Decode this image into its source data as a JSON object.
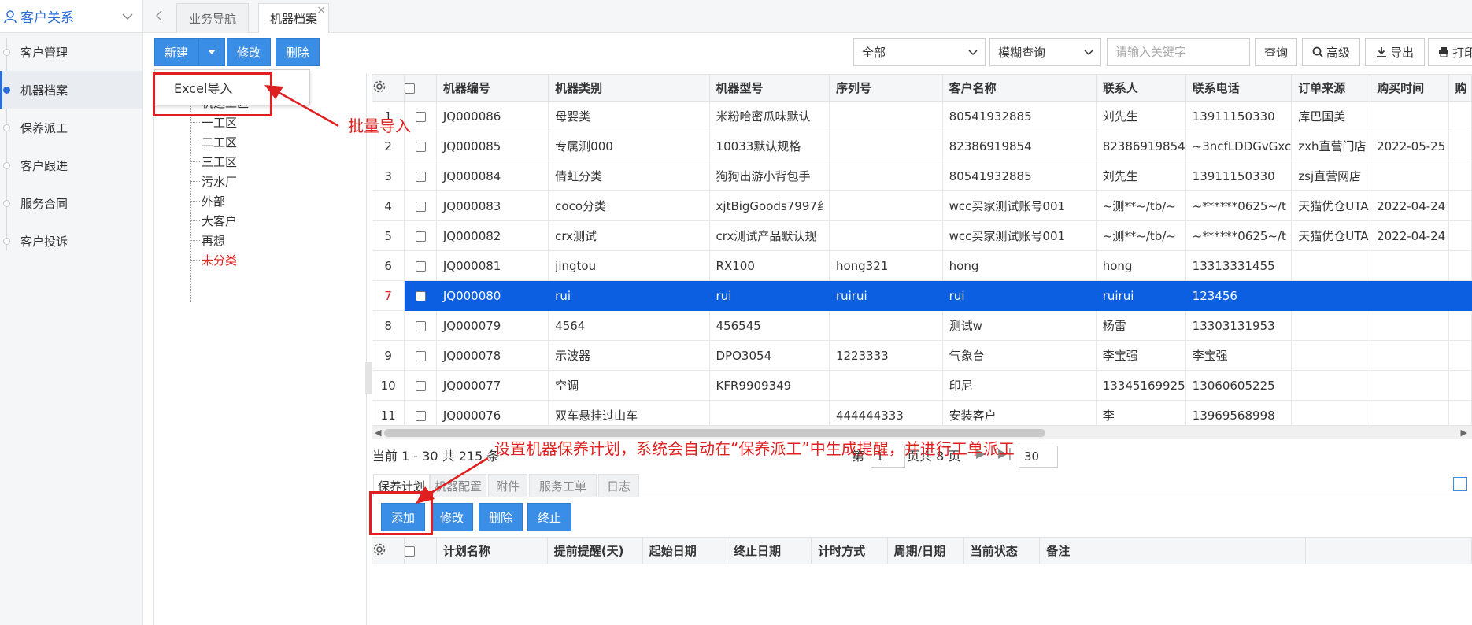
{
  "sidebar": {
    "title": "客户关系",
    "items": [
      {
        "label": "客户管理",
        "active": false
      },
      {
        "label": "机器档案",
        "active": true
      },
      {
        "label": "保养派工",
        "active": false
      },
      {
        "label": "客户跟进",
        "active": false
      },
      {
        "label": "服务合同",
        "active": false
      },
      {
        "label": "客户投诉",
        "active": false
      }
    ]
  },
  "tabs": [
    {
      "label": "业务导航",
      "active": false
    },
    {
      "label": "机器档案",
      "active": true,
      "close": "×"
    }
  ],
  "toolbar": {
    "new_label": "新建",
    "edit_label": "修改",
    "delete_label": "删除",
    "filter_select": "全部",
    "query_mode": "模糊查询",
    "search_placeholder": "请输入关键字",
    "query_label": "查询",
    "advanced_label": "高级",
    "export_label": "导出",
    "print_label": "打印"
  },
  "dropdown": {
    "excel_import": "Excel导入"
  },
  "annotations": {
    "batch_import": "批量导入",
    "maintenance_note": "设置机器保养计划，系统会自动在“保养派工”中生成提醒，并进行工单派工"
  },
  "tree": {
    "items": [
      {
        "label": "机运工区",
        "red": false
      },
      {
        "label": "一工区",
        "red": false
      },
      {
        "label": "二工区",
        "red": false
      },
      {
        "label": "三工区",
        "red": false
      },
      {
        "label": "污水厂",
        "red": false
      },
      {
        "label": "外部",
        "red": false
      },
      {
        "label": "大客户",
        "red": false
      },
      {
        "label": "再想",
        "red": false
      },
      {
        "label": "未分类",
        "red": true
      }
    ]
  },
  "table": {
    "columns": [
      "机器编号",
      "机器类别",
      "机器型号",
      "序列号",
      "客户名称",
      "联系人",
      "联系电话",
      "订单来源",
      "购买时间",
      "购"
    ],
    "rows": [
      {
        "no": "1",
        "cells": [
          "JQ000086",
          "母婴类",
          "米粉哈密瓜味默认",
          "",
          "80541932885",
          "刘先生",
          "13911150330",
          "库巴国美",
          ""
        ],
        "selected": false
      },
      {
        "no": "2",
        "cells": [
          "JQ000085",
          "专属测000",
          "10033默认规格",
          "",
          "82386919854",
          "82386919854",
          "~3ncfLDDGvGxc",
          "zxh直营门店",
          "2022-05-25"
        ],
        "selected": false
      },
      {
        "no": "3",
        "cells": [
          "JQ000084",
          "倩虹分类",
          "狗狗出游小背包手",
          "",
          "80541932885",
          "刘先生",
          "13911150330",
          "zsj直营网店",
          ""
        ],
        "selected": false
      },
      {
        "no": "4",
        "cells": [
          "JQ000083",
          "coco分类",
          "xjtBigGoods7997纟",
          "",
          "wcc买家测试账号001",
          "~测**~/tb/~",
          "~******0625~/t",
          "天猫优仓UTA",
          "2022-04-24"
        ],
        "selected": false
      },
      {
        "no": "5",
        "cells": [
          "JQ000082",
          "crx测试",
          "crx测试产品默认规",
          "",
          "wcc买家测试账号001",
          "~测**~/tb/~",
          "~******0625~/t",
          "天猫优仓UTA",
          "2022-04-24"
        ],
        "selected": false
      },
      {
        "no": "6",
        "cells": [
          "JQ000081",
          "jingtou",
          "RX100",
          "hong321",
          "hong",
          "hong",
          "13313331455",
          "",
          ""
        ],
        "selected": false
      },
      {
        "no": "7",
        "cells": [
          "JQ000080",
          "rui",
          "rui",
          "ruirui",
          "rui",
          "ruirui",
          "123456",
          "",
          ""
        ],
        "selected": true
      },
      {
        "no": "8",
        "cells": [
          "JQ000079",
          "4564",
          "456545",
          "",
          "测试w",
          "杨雷",
          "13303131953",
          "",
          ""
        ],
        "selected": false
      },
      {
        "no": "9",
        "cells": [
          "JQ000078",
          "示波器",
          "DPO3054",
          "1223333",
          "气象台",
          "李宝强",
          "李宝强",
          "",
          ""
        ],
        "selected": false
      },
      {
        "no": "10",
        "cells": [
          "JQ000077",
          "空调",
          "KFR9909349",
          "",
          "印尼",
          "13345169925",
          "13060605225",
          "",
          ""
        ],
        "selected": false
      },
      {
        "no": "11",
        "cells": [
          "JQ000076",
          "双车悬挂过山车",
          "",
          "444444333",
          "安装客户",
          "李",
          "13969568998",
          "",
          ""
        ],
        "selected": false
      }
    ]
  },
  "pager": {
    "summary": "当前 1 - 30 共 215 条",
    "page_label": "第",
    "page_value": "1",
    "total_pages": "页共 8 页",
    "page_size": "30"
  },
  "subtabs": [
    {
      "label": "保养计划",
      "active": true
    },
    {
      "label": "机器配置",
      "active": false
    },
    {
      "label": "附件",
      "active": false
    },
    {
      "label": "服务工单",
      "active": false
    },
    {
      "label": "日志",
      "active": false
    }
  ],
  "subtoolbar": {
    "add_label": "添加",
    "edit_label": "修改",
    "delete_label": "删除",
    "stop_label": "终止"
  },
  "subtable": {
    "columns": [
      "计划名称",
      "提前提醒(天)",
      "起始日期",
      "终止日期",
      "计时方式",
      "周期/日期",
      "当前状态",
      "备注"
    ]
  },
  "colors": {
    "accent": "#3a8ee6",
    "selected_row": "#0b5fe0",
    "annotation": "#e02020"
  }
}
